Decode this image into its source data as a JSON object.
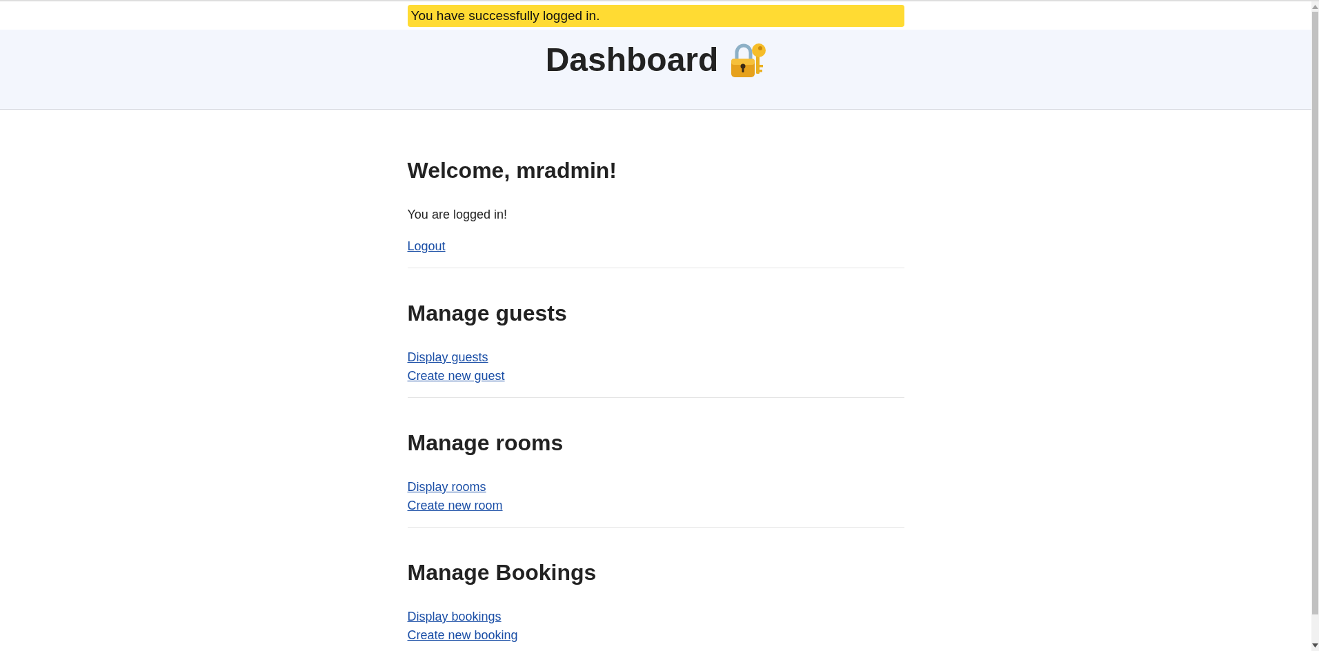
{
  "flash_message": {
    "text": "You have successfully logged in."
  },
  "header": {
    "title": "Dashboard"
  },
  "sections": [
    {
      "heading": "Welcome, mradmin!",
      "paragraph": "You are logged in!",
      "links": [
        "Logout"
      ]
    },
    {
      "heading": "Manage guests",
      "links": [
        "Display guests",
        "Create new guest"
      ]
    },
    {
      "heading": "Manage rooms",
      "links": [
        "Display rooms",
        "Create new room"
      ]
    },
    {
      "heading": "Manage Bookings",
      "links": [
        "Display bookings",
        "Create new booking"
      ]
    }
  ]
}
